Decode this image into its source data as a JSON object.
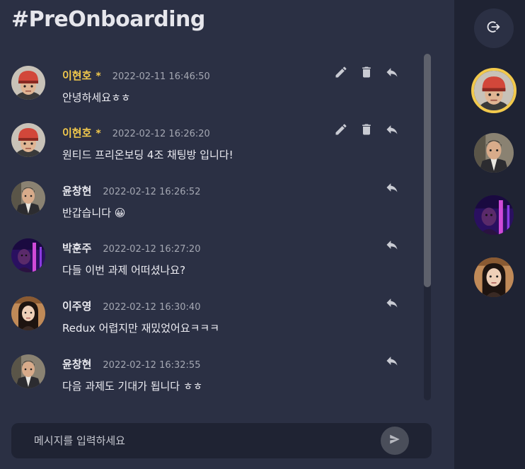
{
  "channel": {
    "title": "#PreOnboarding"
  },
  "messages": [
    {
      "author": "이현호",
      "is_me": true,
      "marker": "*",
      "time": "2022-02-11 16:46:50",
      "text": "안녕하세요ㅎㅎ",
      "avatar": "avatar-helmet",
      "actions": [
        "edit-icon",
        "delete-icon",
        "reply-icon"
      ]
    },
    {
      "author": "이현호",
      "is_me": true,
      "marker": "*",
      "time": "2022-02-12 16:26:20",
      "text": "원티드 프리온보딩 4조 채팅방 입니다!",
      "avatar": "avatar-helmet",
      "actions": [
        "edit-icon",
        "delete-icon",
        "reply-icon"
      ]
    },
    {
      "author": "윤창현",
      "is_me": false,
      "time": "2022-02-12 16:26:52",
      "text": "반갑습니다 😀",
      "avatar": "avatar-suit",
      "actions": [
        "reply-icon"
      ]
    },
    {
      "author": "박훈주",
      "is_me": false,
      "time": "2022-02-12 16:27:20",
      "text": "다들 이번 과제 어떠셨나요?",
      "avatar": "avatar-purple",
      "actions": [
        "reply-icon"
      ]
    },
    {
      "author": "이주영",
      "is_me": false,
      "time": "2022-02-12 16:30:40",
      "text": "Redux 어렵지만 재밌었어요ㅋㅋㅋ",
      "avatar": "avatar-woman",
      "actions": [
        "reply-icon"
      ]
    },
    {
      "author": "윤창현",
      "is_me": false,
      "time": "2022-02-12 16:32:55",
      "text": "다음 과제도 기대가 됩니다 ㅎㅎ",
      "avatar": "avatar-suit",
      "actions": [
        "reply-icon"
      ]
    }
  ],
  "composer": {
    "placeholder": "메시지를 입력하세요",
    "value": ""
  },
  "sidebar": {
    "logout_icon": "logout-icon",
    "members": [
      {
        "avatar": "avatar-helmet",
        "active": true
      },
      {
        "avatar": "avatar-suit",
        "active": false
      },
      {
        "avatar": "avatar-purple",
        "active": false
      },
      {
        "avatar": "avatar-woman",
        "active": false
      }
    ]
  },
  "colors": {
    "background": "#2b3044",
    "sidebar": "#1f2333",
    "accent": "#f2c94c",
    "text": "#e8e8ee",
    "muted": "#a4a7b2"
  }
}
